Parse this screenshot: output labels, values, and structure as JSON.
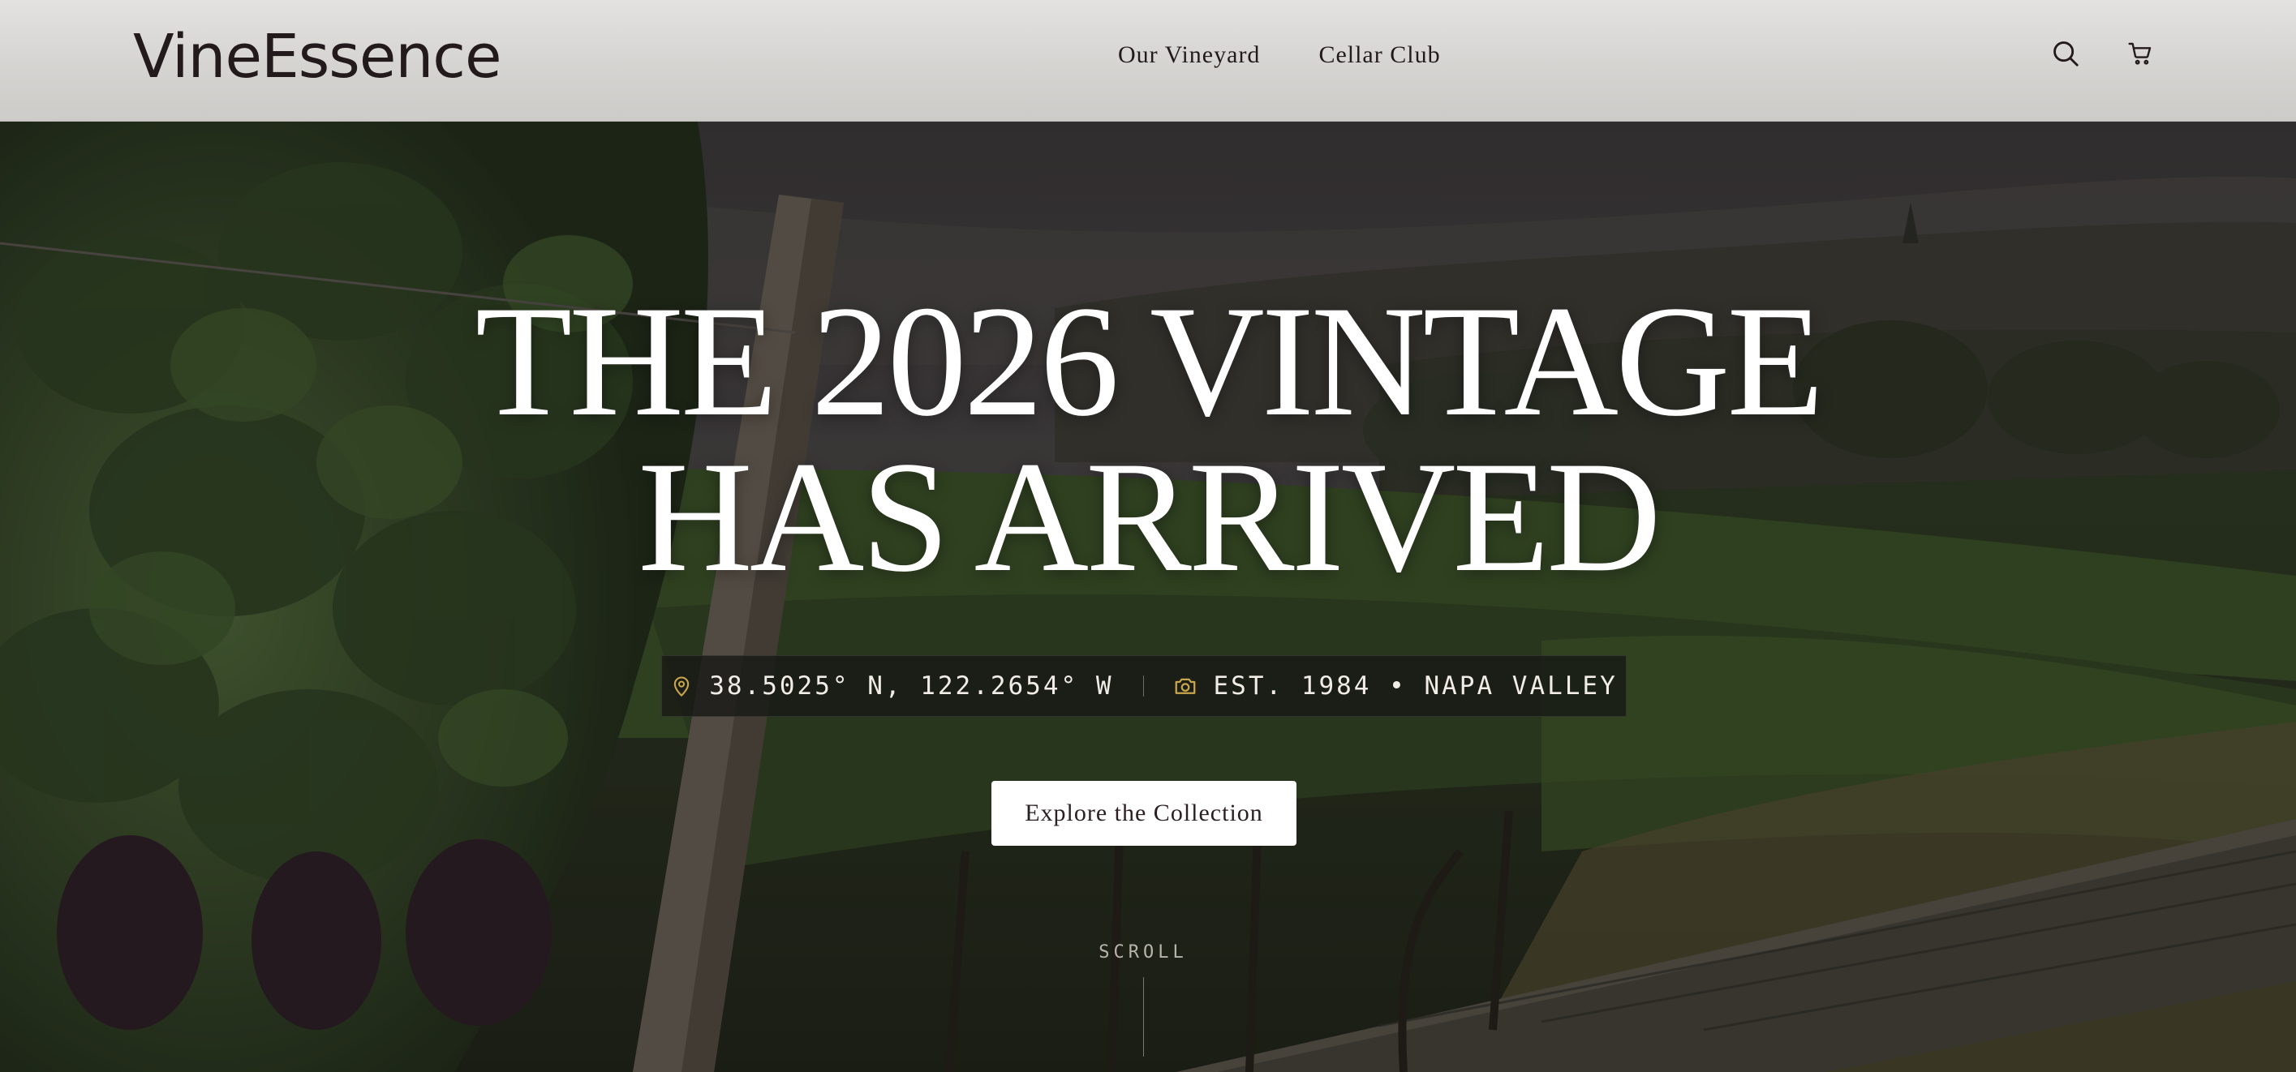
{
  "brand": {
    "logo": "VineEssence"
  },
  "nav": {
    "links": [
      "Our Vineyard",
      "Cellar Club"
    ]
  },
  "header_icons": [
    "search-icon",
    "cart-icon"
  ],
  "hero": {
    "headline_line1": "THE 2026 VINTAGE",
    "headline_line2": "HAS ARRIVED",
    "coordinates": "38.5025° N, 122.2654° W",
    "established": "EST. 1984 • NAPA VALLEY",
    "cta_label": "Explore the Collection",
    "scroll_label": "SCROLL"
  },
  "colors": {
    "header_bg": "#d6d4d1",
    "text_dark": "#231a1c",
    "accent_gold": "#c9a64a",
    "cta_bg": "#ffffff"
  }
}
